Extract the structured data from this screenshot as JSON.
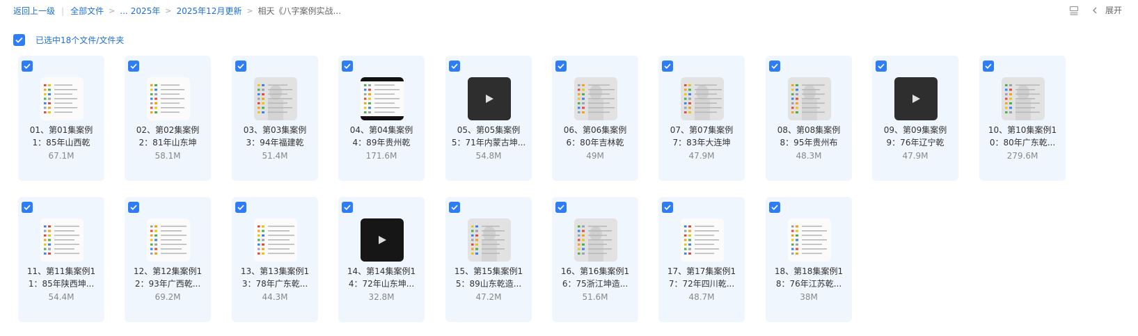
{
  "breadcrumb": {
    "back": "返回上一级",
    "all_files": "全部文件",
    "ellipsis": "...",
    "year": "2025年",
    "month": "2025年12月更新",
    "current": "相天《八字案例实战..."
  },
  "toolbar": {
    "view_icon": "list-view-icon",
    "chevron_icon": "chevron-left-icon",
    "expand_label": "展开"
  },
  "selection": {
    "text": "已选中18个文件/文件夹"
  },
  "colors": {
    "accent": "#2f7df6",
    "card_bg": "#eff6fd",
    "link": "#1e6fd9"
  },
  "files": [
    {
      "line1": "01、第01集案例",
      "line2": "1：85年山西乾",
      "size": "67.1M",
      "thumb": "doc"
    },
    {
      "line1": "02、第02集案例",
      "line2": "2：81年山东坤",
      "size": "58.1M",
      "thumb": "doc"
    },
    {
      "line1": "03、第03集案例",
      "line2": "3：94年福建乾",
      "size": "51.4M",
      "thumb": "photo"
    },
    {
      "line1": "04、第04集案例",
      "line2": "4：89年贵州乾",
      "size": "171.6M",
      "thumb": "letterbox"
    },
    {
      "line1": "05、第05集案例",
      "line2": "5：71年内蒙古坤...",
      "size": "54.8M",
      "thumb": "video"
    },
    {
      "line1": "06、第06集案例",
      "line2": "6：80年吉林乾",
      "size": "49M",
      "thumb": "photo"
    },
    {
      "line1": "07、第07集案例",
      "line2": "7：83年大连坤",
      "size": "47.9M",
      "thumb": "photo"
    },
    {
      "line1": "08、第08集案例",
      "line2": "8：95年贵州布",
      "size": "48.3M",
      "thumb": "photo"
    },
    {
      "line1": "09、第09集案例",
      "line2": "9：76年辽宁乾",
      "size": "47.9M",
      "thumb": "video"
    },
    {
      "line1": "10、第10集案例1",
      "line2": "0：80年广东乾...",
      "size": "279.6M",
      "thumb": "photo"
    },
    {
      "line1": "11、第11集案例1",
      "line2": "1：85年陕西坤...",
      "size": "54.4M",
      "thumb": "doc"
    },
    {
      "line1": "12、第12集案例1",
      "line2": "2：93年广西乾...",
      "size": "69.2M",
      "thumb": "doc"
    },
    {
      "line1": "13、第13集案例1",
      "line2": "3：78年广东乾...",
      "size": "44.3M",
      "thumb": "doc"
    },
    {
      "line1": "14、第14集案例1",
      "line2": "4：72年山东坤...",
      "size": "32.8M",
      "thumb": "dark"
    },
    {
      "line1": "15、第15集案例1",
      "line2": "5：89山东乾造...",
      "size": "47.2M",
      "thumb": "photo"
    },
    {
      "line1": "16、第16集案例1",
      "line2": "6：75浙江坤造...",
      "size": "51.6M",
      "thumb": "photo"
    },
    {
      "line1": "17、第17集案例1",
      "line2": "7：72年四川乾...",
      "size": "48.7M",
      "thumb": "doc"
    },
    {
      "line1": "18、第18集案例1",
      "line2": "8：76年江苏乾...",
      "size": "38M",
      "thumb": "doc"
    }
  ]
}
